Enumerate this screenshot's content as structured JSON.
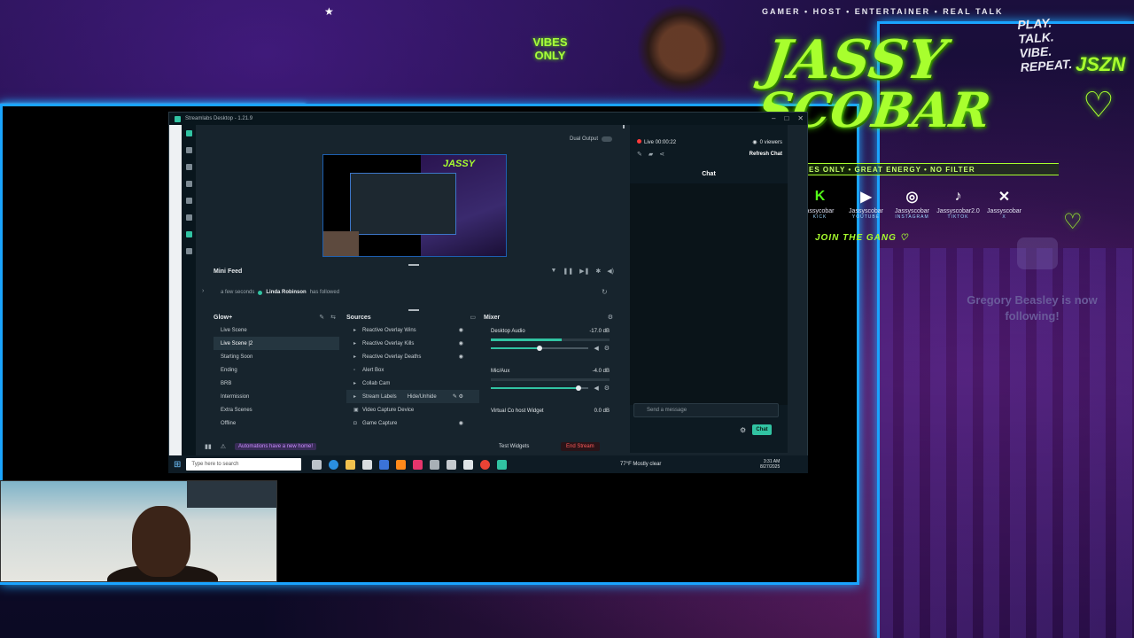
{
  "overlay": {
    "tagline": "GAMER • HOST • ENTERTAINER • REAL TALK",
    "vibes_line1": "VIBES",
    "vibes_line2": "ONLY",
    "brand_line1": "JASSY",
    "brand_line2": "SCOBAR",
    "slogan": [
      "PLAY.",
      "TALK.",
      "VIBE.",
      "REPEAT."
    ],
    "jszn": "JSZN",
    "motto": "ES ONLY • GREAT ENERGY • NO FILTER",
    "socials": [
      {
        "icon": "kick-icon",
        "glyph": "K",
        "handle": "assycobar",
        "platform": "KICK"
      },
      {
        "icon": "youtube-icon",
        "glyph": "▶",
        "handle": "Jassyscobar",
        "platform": "YOUTUBE"
      },
      {
        "icon": "instagram-icon",
        "glyph": "◎",
        "handle": "Jassyscobar",
        "platform": "INSTAGRAM"
      },
      {
        "icon": "tiktok-icon",
        "glyph": "♪",
        "handle": "Jassyscobar2.0",
        "platform": "TIKTOK"
      },
      {
        "icon": "x-icon",
        "glyph": "✕",
        "handle": "Jassyscobar",
        "platform": "X"
      }
    ],
    "join_gang": "JOIN THE GANG ♡",
    "follow_alert": "Gregory Beasley is now following!",
    "accent_color": "#a8ff2e",
    "frame_color": "#1aa4ff"
  },
  "app": {
    "title": "Streamlabs Desktop - 1.21.9",
    "dual_output_label": "Dual Output",
    "mini_feed": {
      "title": "Mini Feed",
      "event": {
        "time": "a few seconds",
        "name": "Linda Robinson",
        "action": "has followed"
      }
    },
    "scenes": {
      "collection": "Glow+",
      "items": [
        "Live Scene",
        "Live Scene |2",
        "Starting Soon",
        "Ending",
        "BRB",
        "Intermission",
        "Extra Scenes",
        "Offline"
      ],
      "selected_index": 1
    },
    "sources": {
      "title": "Sources",
      "items": [
        "Reactive Overlay Wins",
        "Reactive Overlay Kills",
        "Reactive Overlay Deaths",
        "Alert Box",
        "Collab Cam",
        "Stream Labels",
        "Video Capture Device",
        "Game Capture"
      ],
      "hover_tooltip": "Hide/Unhide"
    },
    "mixer": {
      "title": "Mixer",
      "channels": [
        {
          "name": "Desktop Audio",
          "level": "-17.0 dB",
          "meter": 0.6,
          "volume": 0.5
        },
        {
          "name": "Mic/Aux",
          "level": "-4.0 dB",
          "meter": 0.0,
          "volume": 0.9
        },
        {
          "name": "Virtual Co host Widget",
          "level": "0.0 dB",
          "meter": 0.0,
          "volume": 0.0
        }
      ]
    },
    "footer": {
      "automation": "Automations have a new home!",
      "test_widgets": "Test Widgets",
      "end_stream": "End Stream"
    },
    "chat": {
      "live_time": "Live 00:00:22",
      "viewers": "0 viewers",
      "refresh": "Refresh Chat",
      "tab": "Chat",
      "placeholder": "Send a message",
      "send_label": "Chat"
    }
  },
  "taskbar": {
    "search_placeholder": "Type here to search",
    "weather": "77°F Mostly clear",
    "time": "3:31 AM",
    "date": "8/27/2025"
  }
}
